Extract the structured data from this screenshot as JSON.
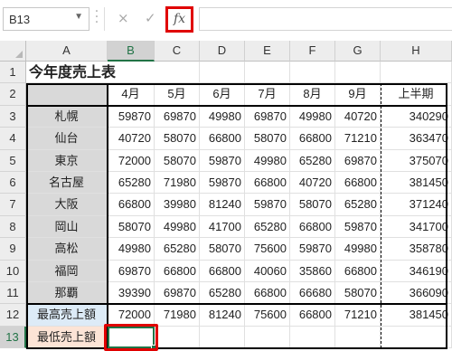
{
  "formula_bar": {
    "name_box": "B13",
    "cancel_icon": "×",
    "enter_icon": "✓",
    "fx_label": "fx",
    "formula": ""
  },
  "columns": [
    "A",
    "B",
    "C",
    "D",
    "E",
    "F",
    "G",
    "H"
  ],
  "rows": [
    "1",
    "2",
    "3",
    "4",
    "5",
    "6",
    "7",
    "8",
    "9",
    "10",
    "11",
    "12",
    "13"
  ],
  "sheet": {
    "title": "今年度売上表",
    "months": [
      "4月",
      "5月",
      "6月",
      "7月",
      "8月",
      "9月",
      "上半期"
    ],
    "cities": [
      {
        "name": "札幌",
        "values": [
          "59870",
          "69870",
          "49980",
          "69870",
          "49980",
          "40720",
          "340290"
        ]
      },
      {
        "name": "仙台",
        "values": [
          "40720",
          "58070",
          "66800",
          "58070",
          "66800",
          "71210",
          "363470"
        ]
      },
      {
        "name": "東京",
        "values": [
          "72000",
          "58070",
          "59870",
          "49980",
          "65280",
          "69870",
          "375070"
        ]
      },
      {
        "name": "名古屋",
        "values": [
          "65280",
          "71980",
          "59870",
          "66800",
          "40720",
          "66800",
          "381450"
        ]
      },
      {
        "name": "大阪",
        "values": [
          "66800",
          "39980",
          "81240",
          "59870",
          "58070",
          "65280",
          "371240"
        ]
      },
      {
        "name": "岡山",
        "values": [
          "58070",
          "49980",
          "41700",
          "65280",
          "66800",
          "59870",
          "341700"
        ]
      },
      {
        "name": "高松",
        "values": [
          "49980",
          "65280",
          "58070",
          "75600",
          "59870",
          "49980",
          "358780"
        ]
      },
      {
        "name": "福岡",
        "values": [
          "69870",
          "66800",
          "66800",
          "40060",
          "35860",
          "66800",
          "346190"
        ]
      },
      {
        "name": "那覇",
        "values": [
          "39390",
          "69870",
          "65280",
          "66800",
          "66680",
          "58070",
          "366090"
        ]
      }
    ],
    "max_row": {
      "label": "最高売上額",
      "values": [
        "72000",
        "71980",
        "81240",
        "75600",
        "66800",
        "71210",
        "381450"
      ]
    },
    "min_row": {
      "label": "最低売上額",
      "values": [
        "",
        "",
        "",
        "",
        "",
        "",
        ""
      ]
    }
  },
  "colors": {
    "accent": "#217346",
    "highlight": "#e00000",
    "label_fill": "#d9d9d9",
    "max_fill": "#ddebf7",
    "min_fill": "#fce4d6"
  }
}
